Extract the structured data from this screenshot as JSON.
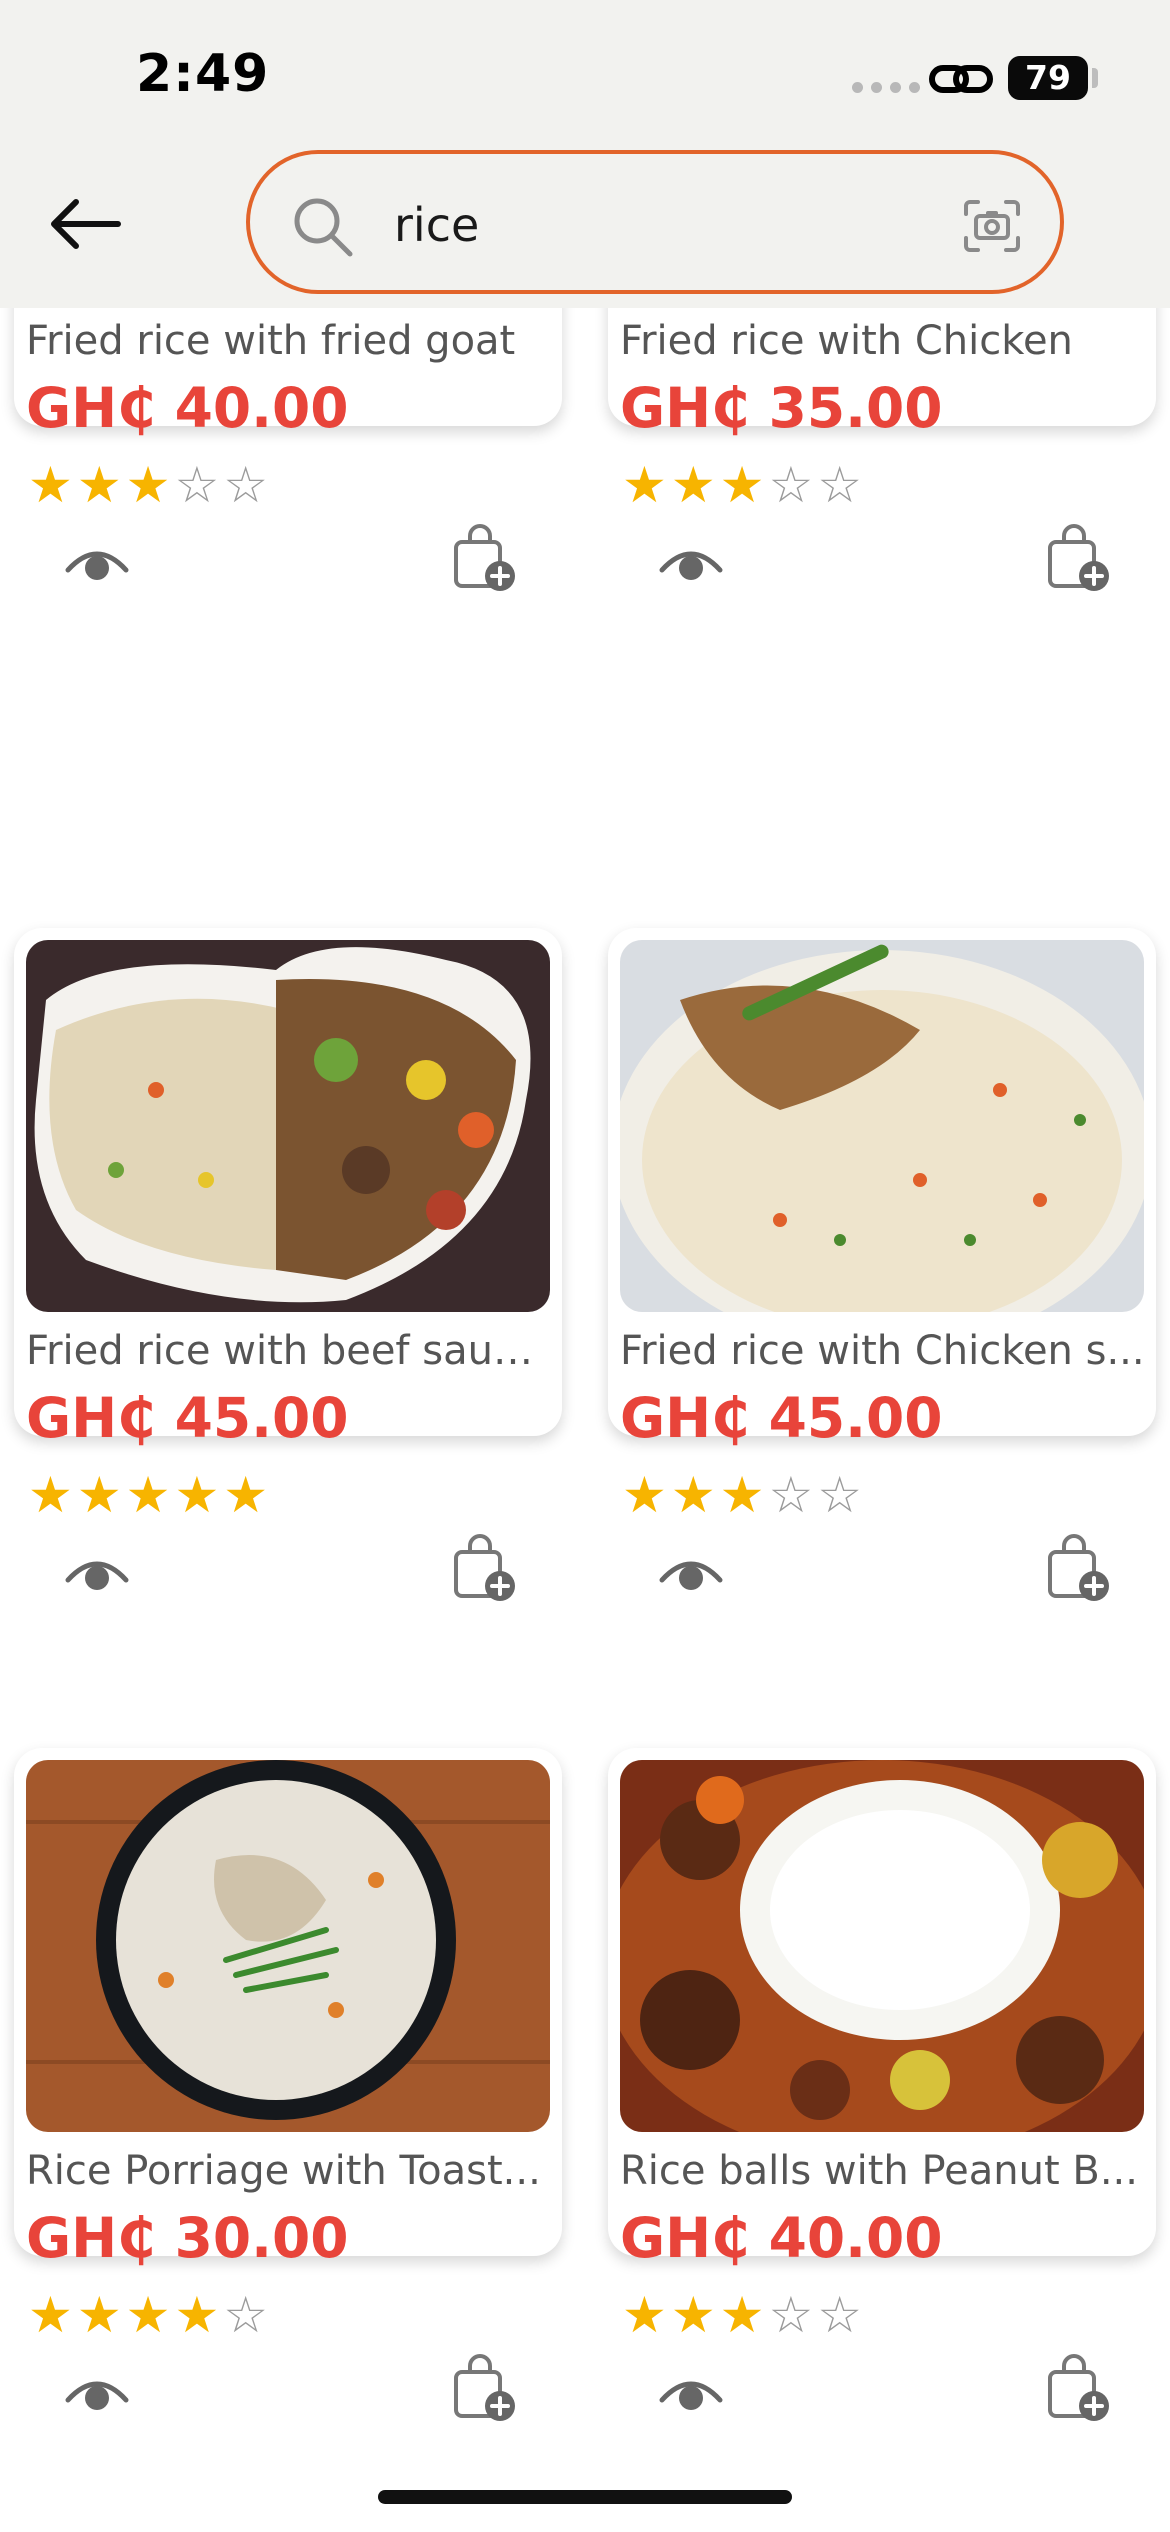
{
  "status_bar": {
    "time": "2:49",
    "battery": "79"
  },
  "search": {
    "value": "rice",
    "placeholder": "Search"
  },
  "products": [
    {
      "name": "Fried rice with fried goat",
      "price": "GH₵ 40.00",
      "rating": 3
    },
    {
      "name": "Fried rice with Chicken",
      "price": "GH₵ 35.00",
      "rating": 3
    },
    {
      "name": "Fried rice with beef sauc...",
      "price": "GH₵ 45.00",
      "rating": 5
    },
    {
      "name": "Fried rice with Chicken s...",
      "price": "GH₵ 45.00",
      "rating": 3
    },
    {
      "name": "Rice Porriage with Toast...",
      "price": "GH₵ 30.00",
      "rating": 4
    },
    {
      "name": "Rice balls with Peanut B...",
      "price": "GH₵ 40.00",
      "rating": 3
    }
  ],
  "icons": {
    "back": "arrow-left-icon",
    "search": "search-icon",
    "camera": "camera-icon",
    "view": "eye-icon",
    "add_to_cart": "cart-add-icon"
  },
  "colors": {
    "accent": "#e2642a",
    "price": "#e8443a",
    "star": "#f7b400"
  }
}
